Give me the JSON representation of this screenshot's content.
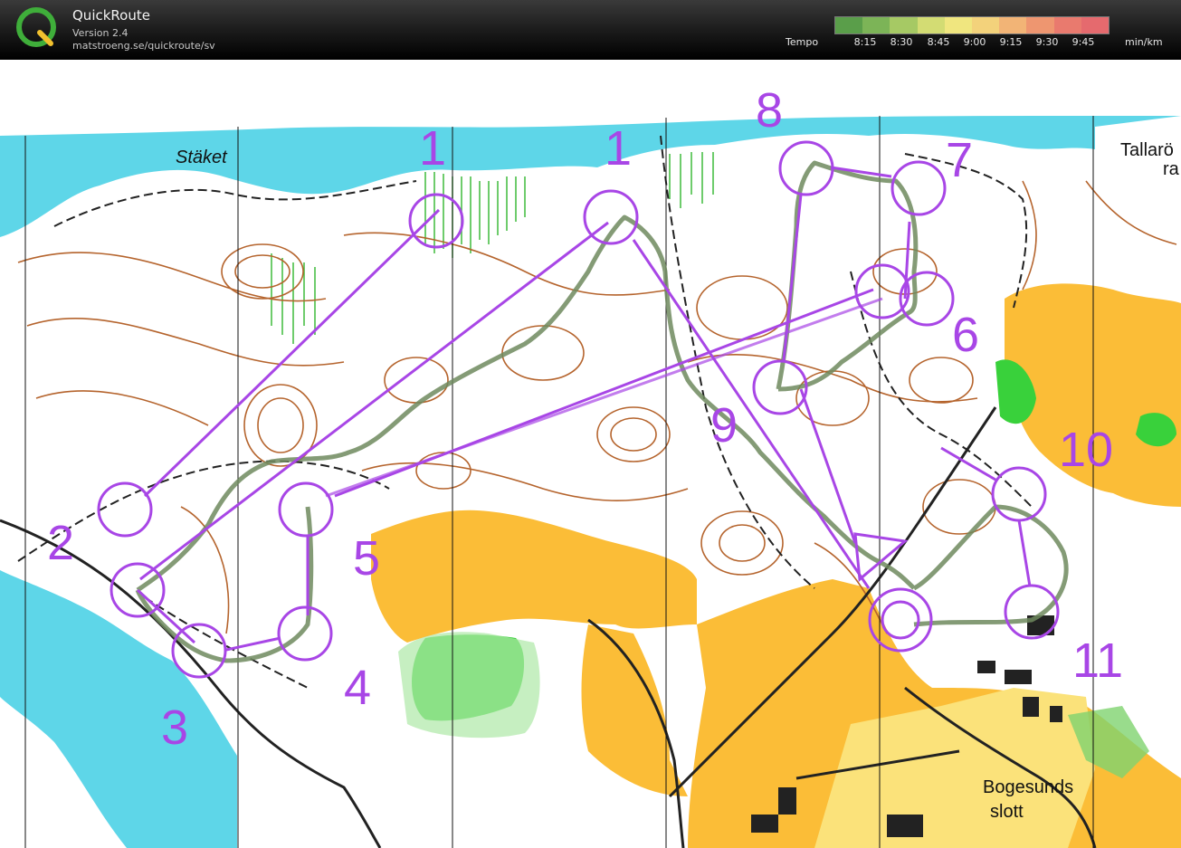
{
  "app": {
    "title": "QuickRoute",
    "version": "Version 2.4",
    "url": "matstroeng.se/quickroute/sv"
  },
  "tempo": {
    "label": "Tempo",
    "unit": "min/km",
    "ticks": [
      "8:15",
      "8:30",
      "8:45",
      "9:00",
      "9:15",
      "9:30",
      "9:45"
    ],
    "gradient_colors": [
      "#5a9e4a",
      "#7cb457",
      "#a6c964",
      "#d3dc73",
      "#f0e67f",
      "#f3d27b",
      "#f2b476",
      "#ee9670",
      "#e97a6e",
      "#e56a6e"
    ]
  },
  "map": {
    "place_names": [
      "Stäket",
      "Tallarö",
      "ra",
      "Bogesunds",
      "slott"
    ],
    "colors": {
      "water": "#5ed6e8",
      "open_land": "#fbbd37",
      "green": "#39d13b",
      "course": "#a846e6",
      "route": "#4f7a3e",
      "contour": "#b5642d"
    },
    "control_labels": [
      "1",
      "1",
      "8",
      "7",
      "6",
      "10",
      "9",
      "2",
      "5",
      "3",
      "4",
      "11"
    ]
  }
}
